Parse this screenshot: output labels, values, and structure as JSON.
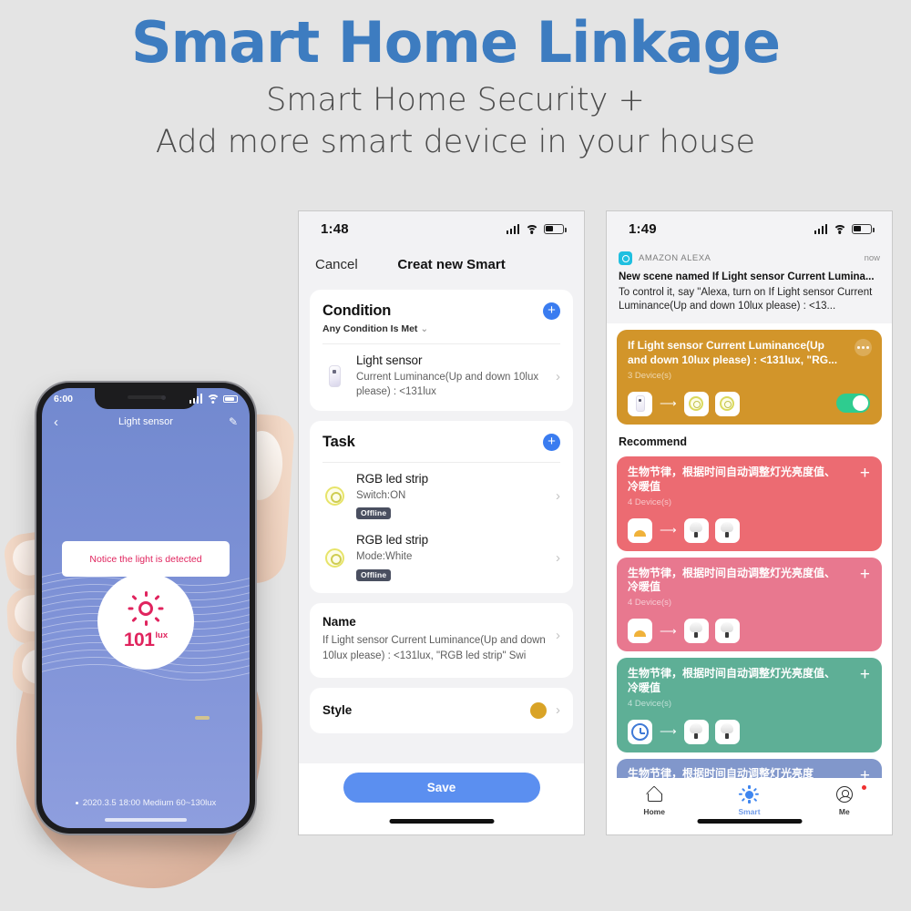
{
  "header": {
    "title": "Smart Home Linkage",
    "subtitle_line1": "Smart Home Security +",
    "subtitle_line2": "Add more smart device in your house",
    "title_color": "#3d7cc0"
  },
  "left_phone": {
    "status": {
      "time": "6:00"
    },
    "nav": {
      "back_icon": "chevron-left-icon",
      "title": "Light sensor",
      "edit_icon": "pencil-icon"
    },
    "toast": "Notice the light is detected",
    "dial": {
      "icon": "sun-icon",
      "value": "101",
      "unit": "lux",
      "accent": "#e0245e"
    },
    "footer": "2020.3.5 18:00 Medium 60~130lux"
  },
  "mid_phone": {
    "status": {
      "time": "1:48"
    },
    "nav": {
      "cancel": "Cancel",
      "title": "Creat new Smart"
    },
    "condition_card": {
      "title": "Condition",
      "subtitle": "Any Condition Is Met",
      "add_icon": "plus-circle-icon",
      "rows": [
        {
          "icon": "light-sensor-icon",
          "title": "Light sensor",
          "desc": "Current Luminance(Up and down 10lux please) : <131lux"
        }
      ]
    },
    "task_card": {
      "title": "Task",
      "add_icon": "plus-circle-icon",
      "rows": [
        {
          "icon": "led-strip-icon",
          "title": "RGB led strip",
          "desc": "Switch:ON",
          "badge": "Offline"
        },
        {
          "icon": "led-strip-icon",
          "title": "RGB led strip",
          "desc": "Mode:White",
          "badge": "Offline"
        }
      ]
    },
    "name_card": {
      "title": "Name",
      "value": "If Light sensor Current Luminance(Up and down 10lux please) : <131lux, \"RGB led strip\" Swi"
    },
    "style_card": {
      "title": "Style",
      "swatch_color": "#d9a326"
    },
    "save_label": "Save",
    "save_color": "#5b8ff0"
  },
  "right_phone": {
    "status": {
      "time": "1:49"
    },
    "notification": {
      "app_icon": "alexa-icon",
      "app": "AMAZON ALEXA",
      "time": "now",
      "title": "New scene named If Light sensor Current Lumina...",
      "body": "To control it, say \"Alexa, turn on If Light sensor Current Luminance(Up and down 10lux please) : <13..."
    },
    "active_scene": {
      "title": "If Light sensor Current Luminance(Up and down 10lux please) : <131lux, \"RG...",
      "count": "3 Device(s)",
      "menu_icon": "more-dots-icon",
      "color": "#d2952a",
      "toggle_on": true,
      "devices": [
        "light-sensor-icon",
        "led-strip-icon",
        "led-strip-icon"
      ]
    },
    "recommend_label": "Recommend",
    "recommend": [
      {
        "title": "生物节律，根据时间自动调整灯光亮度值、冷暖值",
        "count": "4 Device(s)",
        "color": "#ec6b72",
        "trigger_icon": "sunrise-icon",
        "devices": [
          "lamp-icon",
          "lamp-icon"
        ],
        "add_icon": "plus-icon"
      },
      {
        "title": "生物节律，根据时间自动调整灯光亮度值、冷暖值",
        "count": "4 Device(s)",
        "color": "#e8788f",
        "trigger_icon": "sunrise-icon",
        "devices": [
          "lamp-icon",
          "lamp-icon"
        ],
        "add_icon": "plus-icon"
      },
      {
        "title": "生物节律，根据时间自动调整灯光亮度值、冷暖值",
        "count": "4 Device(s)",
        "color": "#5eaf96",
        "trigger_icon": "clock-icon",
        "devices": [
          "lamp-icon",
          "lamp-icon"
        ],
        "add_icon": "plus-icon"
      },
      {
        "title": "生物节律，根据时间自动调整灯光亮度",
        "count": "",
        "color": "#8197cb",
        "trigger_icon": "clock-icon",
        "devices": [],
        "add_icon": "plus-icon"
      }
    ],
    "tabs": [
      {
        "label": "Home",
        "icon": "home-icon",
        "active": false
      },
      {
        "label": "Smart",
        "icon": "smart-sun-icon",
        "active": true
      },
      {
        "label": "Me",
        "icon": "profile-icon",
        "active": false,
        "badge": true
      }
    ]
  }
}
